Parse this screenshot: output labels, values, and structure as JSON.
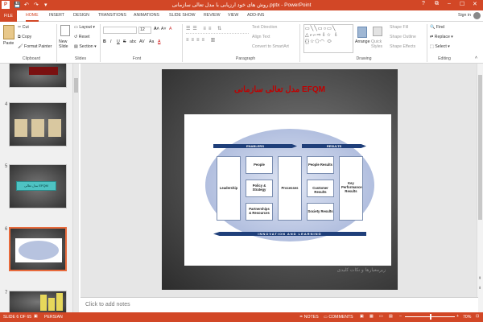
{
  "window": {
    "title": "روش های خود ارزیابی با مدل تعالی سازمانی.pptx - PowerPoint",
    "minimize": "–",
    "maximize": "☐",
    "close": "✕",
    "help": "?",
    "restore": "⧉"
  },
  "quick_access": {
    "save": "💾",
    "undo": "↶",
    "redo": "↷",
    "customize": "▾"
  },
  "tabs": [
    "FILE",
    "HOME",
    "INSERT",
    "DESIGN",
    "TRANSITIONS",
    "ANIMATIONS",
    "SLIDE SHOW",
    "REVIEW",
    "VIEW",
    "ADD-INS"
  ],
  "active_tab": "HOME",
  "account": {
    "sign_in": "Sign in"
  },
  "ribbon": {
    "clipboard": {
      "label": "Clipboard",
      "paste": "Paste",
      "cut": "Cut",
      "copy": "Copy",
      "format_painter": "Format Painter"
    },
    "slides": {
      "label": "Slides",
      "new_slide": "New Slide",
      "layout": "Layout",
      "reset": "Reset",
      "section": "Section"
    },
    "font": {
      "label": "Font",
      "font_size": "12",
      "bold": "B",
      "italic": "I",
      "underline": "U",
      "strike": "S",
      "shadow": "abc",
      "spacing": "AV",
      "case": "Aa",
      "color": "A",
      "grow": "A˄",
      "shrink": "A˅",
      "clear": "A"
    },
    "paragraph": {
      "label": "Paragraph",
      "text_direction": "Text Direction",
      "align_text": "Align Text",
      "convert_smartart": "Convert to SmartArt"
    },
    "drawing": {
      "label": "Drawing",
      "arrange": "Arrange",
      "quick_styles": "Quick Styles",
      "shape_fill": "Shape Fill",
      "shape_outline": "Shape Outline",
      "shape_effects": "Shape Effects"
    },
    "editing": {
      "label": "Editing",
      "find": "Find",
      "replace": "Replace",
      "select": "Select"
    }
  },
  "thumbnails": [
    {
      "num": "4"
    },
    {
      "num": "5"
    },
    {
      "num": "6"
    },
    {
      "num": "7"
    }
  ],
  "slide": {
    "title": "مدل تعالی سازمانی EFQM",
    "enablers": "ENABLERS",
    "results": "RESULTS",
    "innovation": "INNOVATION AND LEARNING",
    "leadership": "Leadership",
    "people": "People",
    "policy": "Policy & Strategy",
    "partnerships": "Partnerships & Resources",
    "processes": "Processes",
    "people_results": "People Results",
    "customer_results": "Customer Results",
    "society_results": "Society Results",
    "key_results": "Key Performance Results",
    "footer": "زیرمعیارها و نکات کلیدی"
  },
  "thumb5_text": "مدل تعالی EFQM",
  "notes": {
    "placeholder": "Click to add notes"
  },
  "status": {
    "slide": "SLIDE 6 OF 65",
    "language": "PERSIAN",
    "notes": "NOTES",
    "comments": "COMMENTS",
    "zoom": "70%"
  }
}
